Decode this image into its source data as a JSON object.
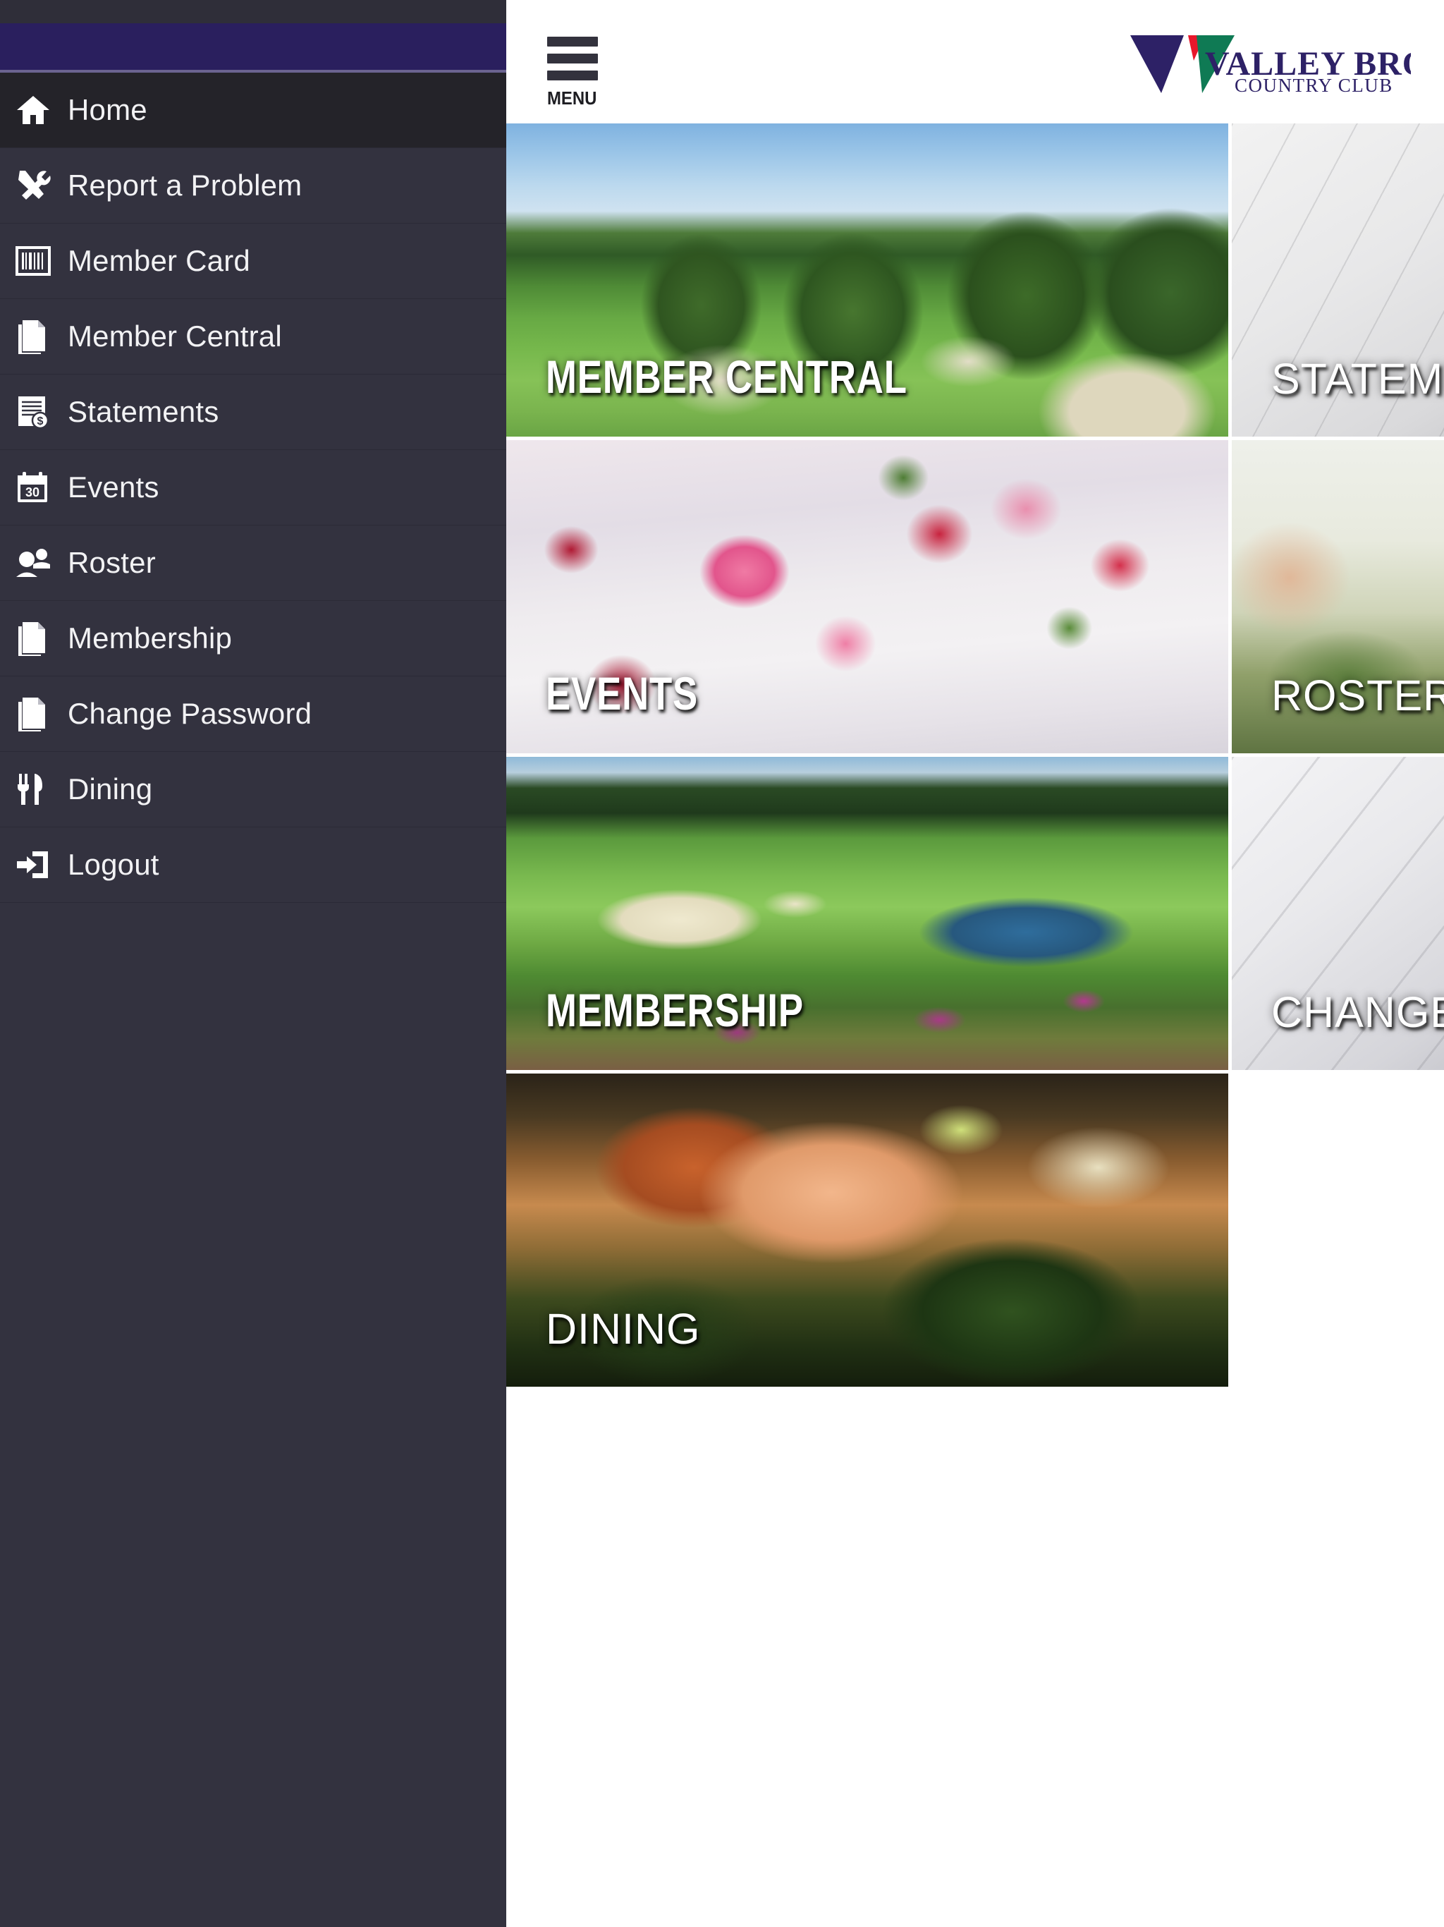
{
  "app": {
    "title": "Valley Brook Country Club",
    "brand_colors": {
      "navy": "#2d2166",
      "green": "#0f7a54",
      "red": "#e8172b",
      "drawer_accent": "#2a1f5e",
      "sidebar_bg": "#33323f",
      "sidebar_active": "#242329"
    }
  },
  "header": {
    "menu_button_label": "MENU",
    "menu_icon": "hamburger-icon",
    "logo": {
      "line1": "VALLEY BROOK",
      "line2": "COUNTRY CLUB",
      "mark": "valley-brook-v-mark"
    }
  },
  "sidebar": {
    "items": [
      {
        "label": "Home",
        "icon": "home-icon",
        "active": true
      },
      {
        "label": "Report a Problem",
        "icon": "tools-icon",
        "active": false
      },
      {
        "label": "Member Card",
        "icon": "barcode-icon",
        "active": false
      },
      {
        "label": "Member Central",
        "icon": "document-icon",
        "active": false
      },
      {
        "label": "Statements",
        "icon": "invoice-dollar-icon",
        "active": false
      },
      {
        "label": "Events",
        "icon": "calendar-30-icon",
        "active": false
      },
      {
        "label": "Roster",
        "icon": "people-icon",
        "active": false
      },
      {
        "label": "Membership",
        "icon": "document-icon",
        "active": false
      },
      {
        "label": "Change Password",
        "icon": "document-icon",
        "active": false
      },
      {
        "label": "Dining",
        "icon": "cutlery-icon",
        "active": false
      },
      {
        "label": "Logout",
        "icon": "logout-arrow-icon",
        "active": false
      }
    ]
  },
  "main": {
    "tiles": [
      {
        "label": "MEMBER CENTRAL",
        "image": "golf-course-fairway-trees",
        "style": "condensed"
      },
      {
        "label": "STATEMENTS",
        "image": "billing-statement-closeup",
        "style": "regular"
      },
      {
        "label": "EVENTS",
        "image": "banquet-table-floral-setting",
        "style": "condensed"
      },
      {
        "label": "ROSTER",
        "image": "woman-in-yellow-cap-outdoors",
        "style": "regular"
      },
      {
        "label": "MEMBERSHIP",
        "image": "golf-green-pond-flowerbed",
        "style": "condensed"
      },
      {
        "label": "CHANGE PASSWORD",
        "image": "silverware-closeup",
        "style": "regular"
      },
      {
        "label": "DINING",
        "image": "salmon-entree-plated",
        "style": "regular"
      }
    ]
  }
}
